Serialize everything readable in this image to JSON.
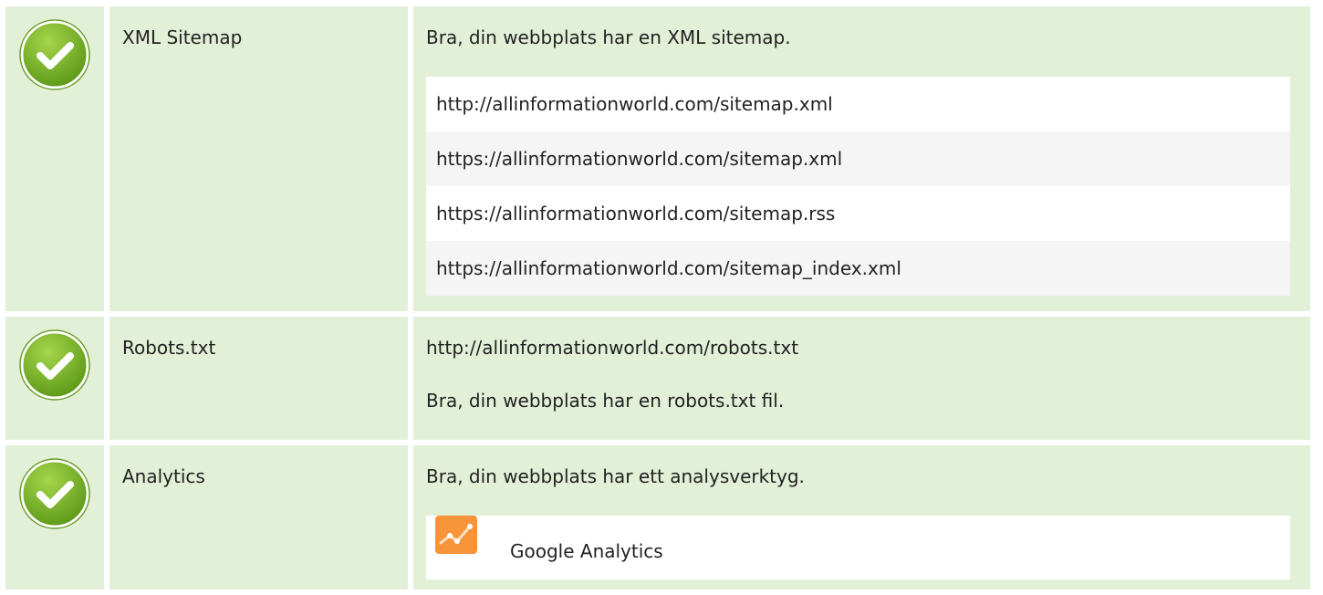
{
  "rows": [
    {
      "label": "XML Sitemap",
      "message": "Bra, din webbplats har en XML sitemap.",
      "urls": [
        "http://allinformationworld.com/sitemap.xml",
        "https://allinformationworld.com/sitemap.xml",
        "https://allinformationworld.com/sitemap.rss",
        "https://allinformationworld.com/sitemap_index.xml"
      ]
    },
    {
      "label": "Robots.txt",
      "url": "http://allinformationworld.com/robots.txt",
      "message": "Bra, din webbplats har en robots.txt fil."
    },
    {
      "label": "Analytics",
      "message": "Bra, din webbplats har ett analysverktyg.",
      "tool": "Google Analytics"
    }
  ],
  "icons": {
    "status": "check-circle-icon",
    "tool": "google-analytics-icon"
  },
  "colors": {
    "row_bg": "#e3f0d8",
    "check_green": "#7ab928",
    "ga_orange": "#f8943a"
  }
}
